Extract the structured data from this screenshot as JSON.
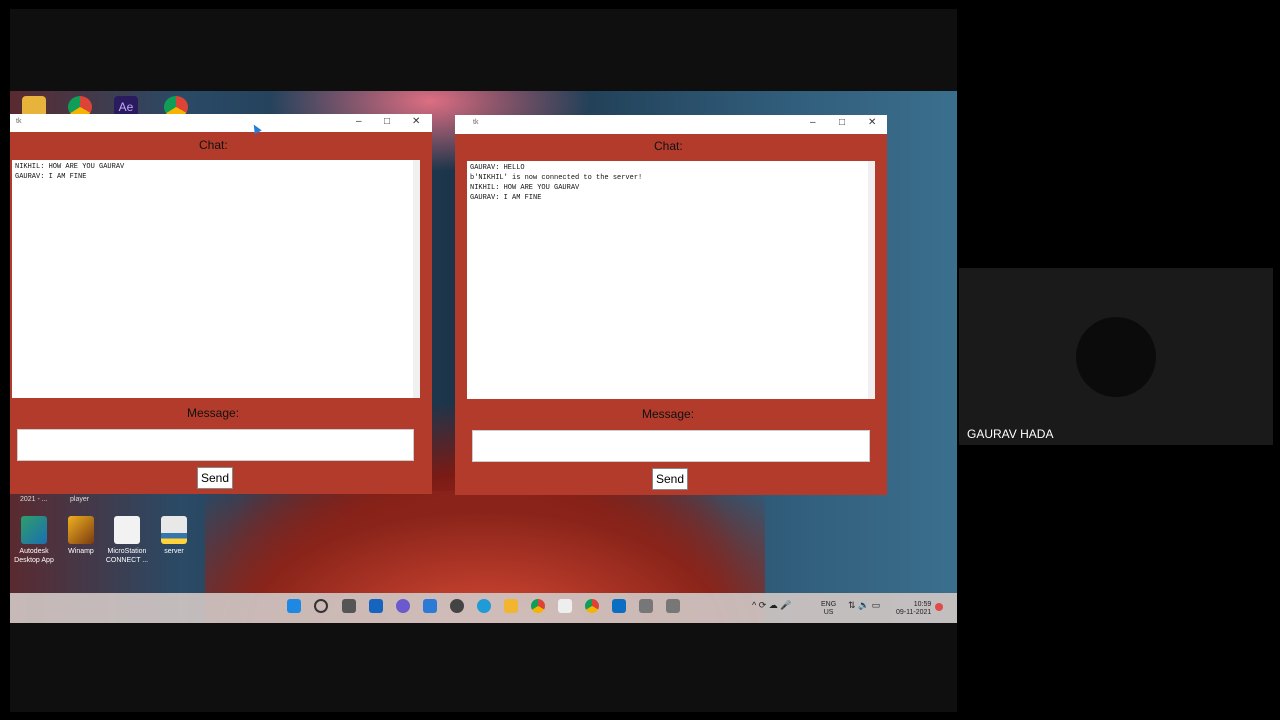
{
  "desktop": {
    "icons": [
      {
        "label": "Autodesk Desktop App",
        "icon": "autodesk-icon",
        "color": "#2f9e6a"
      },
      {
        "label": "Winamp",
        "icon": "winamp-icon",
        "color": "#d07a16"
      },
      {
        "label": "MicroStation CONNECT ...",
        "icon": "file-icon",
        "color": "#f2f2f2"
      },
      {
        "label": "server",
        "icon": "python-file-icon",
        "color": "#e8e8e8"
      }
    ],
    "captions": [
      "2021 - ...",
      "player"
    ]
  },
  "window_left": {
    "title": "tk",
    "chat_label": "Chat:",
    "message_label": "Message:",
    "send_label": "Send",
    "chat_lines": [
      "NIKHIL: HOW ARE YOU GAURAV",
      "GAURAV: I AM FINE"
    ],
    "message_value": ""
  },
  "window_right": {
    "title": "tk",
    "chat_label": "Chat:",
    "message_label": "Message:",
    "send_label": "Send",
    "chat_lines": [
      "GAURAV: HELLO",
      "b'NIKHIL' is now connected to the server!",
      "NIKHIL: HOW ARE YOU GAURAV",
      "GAURAV: I AM FINE"
    ],
    "message_value": ""
  },
  "taskbar": {
    "lang": "ENG",
    "region": "US",
    "time": "10:59",
    "date": "09-11-2021"
  },
  "participant": {
    "name": "GAURAV HADA"
  },
  "colors": {
    "window_bg": "#b23b2b",
    "taskbar": "#cfc5c3"
  }
}
